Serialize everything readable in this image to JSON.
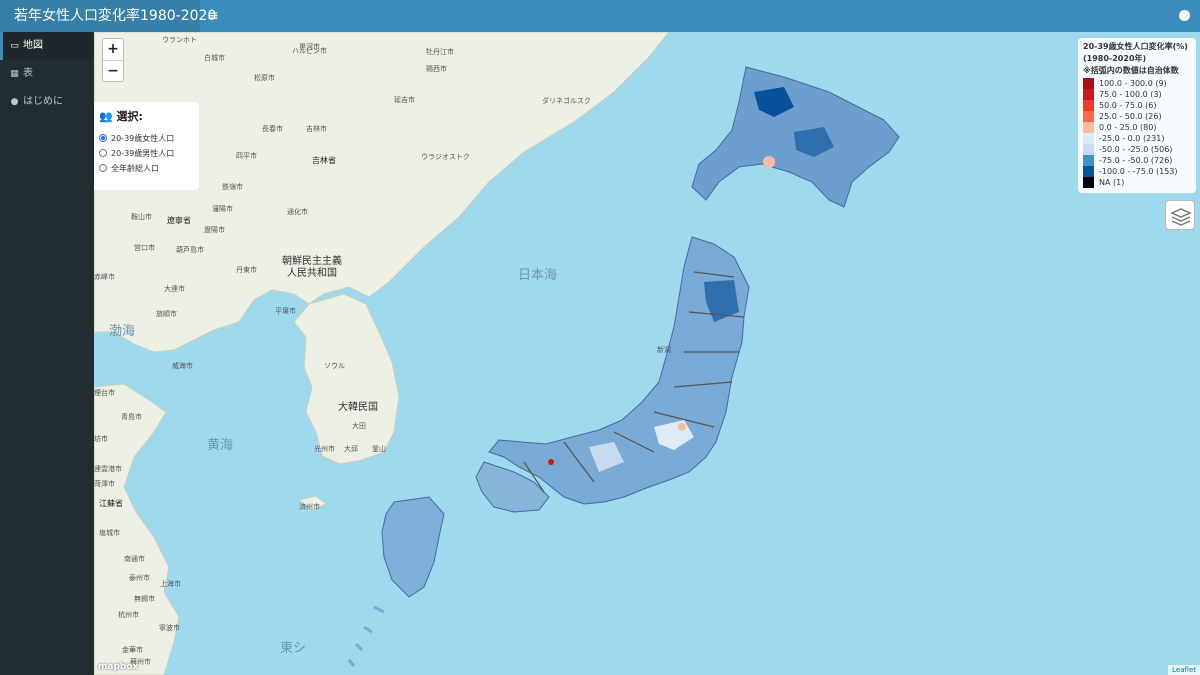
{
  "header": {
    "title": "若年女性人口変化率1980-2020",
    "menu_icon": "hamburger-icon",
    "repo_icon": "github-icon"
  },
  "sidebar": {
    "items": [
      {
        "label": "地図",
        "icon": "map-icon",
        "glyph": "▭",
        "active": true
      },
      {
        "label": "表",
        "icon": "table-icon",
        "glyph": "▦",
        "active": false
      },
      {
        "label": "はじめに",
        "icon": "info-icon",
        "glyph": "●",
        "active": false
      }
    ]
  },
  "map": {
    "zoom_in": "+",
    "zoom_out": "−",
    "labels": {
      "uranhot": "ウランホト",
      "heihe": "黒河市",
      "harbin": "ハルビン市",
      "mudanjiang": "牡丹江市",
      "jixi": "鶏西市",
      "baicheng": "白城市",
      "songyuan": "松原市",
      "changchun": "長春市",
      "jilin_city": "吉林市",
      "jilin_prov": "吉林省",
      "siping": "四平市",
      "yanji": "延吉市",
      "dalian": "遼陽市",
      "ulakit": "ウラジオストク",
      "danyang": "丹東市",
      "pyongyang": "平壌市",
      "seoul": "ソウル",
      "busan": "釜山",
      "jeju": "済州市",
      "gwangju": "光州市",
      "daejeon": "大田",
      "nagasaki": "大邱",
      "sea_of_japan": "日本海",
      "bohai": "渤海",
      "yellow_sea": "黄海",
      "east_sea": "東シ",
      "niigata": "新潟",
      "dalinegorsk": "ダリネゴルスク",
      "liaoning": "遼寧省",
      "korea_nk": "朝鮮民主主義\n人民共和国",
      "korea_sk": "大韓民国",
      "jiangsu": "江蘇省",
      "qingdao": "青島市",
      "weihai": "威海市",
      "yantai": "煙台市",
      "dandong2": "通化市",
      "tieling": "鉄嶺市",
      "shenyang": "瀋陽市",
      "anshan": "鞍山市",
      "yingkou": "営口市",
      "huludao": "葫芦島市",
      "chifeng": "赤峰市",
      "dalian2": "大連市",
      "lushun": "旅順市",
      "nantong": "南通市",
      "shanghai": "上海市",
      "hangzhou": "杭州市",
      "ningbo": "寧波市",
      "suzhou": "蘇州市",
      "taizhou": "泰州市",
      "wuxi": "無錫市",
      "jinhua": "金華市",
      "weifang": "坊市",
      "lianyungang": "連雲港市",
      "heze": "菏澤市",
      "yancheng": "塩城市"
    },
    "credit": "mapbox",
    "attribution": "Leaflet",
    "layers_icon": "layers-icon"
  },
  "selector": {
    "title": "選択:",
    "icon": "users-icon",
    "options": [
      {
        "label": "20-39歳女性人口",
        "checked": true
      },
      {
        "label": "20-39歳男性人口",
        "checked": false
      },
      {
        "label": "全年齢総人口",
        "checked": false
      }
    ]
  },
  "legend": {
    "title_1": "20-39歳女性人口変化率(%)",
    "title_2": "(1980-2020年)",
    "title_3": "※括弧内の数値は自治体数",
    "items": [
      {
        "label": "100.0 - 300.0 (9)",
        "color": "#a50f15"
      },
      {
        "label": "75.0 - 100.0 (3)",
        "color": "#cb181d"
      },
      {
        "label": "50.0 - 75.0 (6)",
        "color": "#ef3b2c"
      },
      {
        "label": "25.0 - 50.0 (26)",
        "color": "#fb6a4a"
      },
      {
        "label": "0.0 - 25.0 (80)",
        "color": "#fcbba1"
      },
      {
        "label": "-25.0 - 0.0 (231)",
        "color": "#deebf7"
      },
      {
        "label": "-50.0 - -25.0 (506)",
        "color": "#c6dbef"
      },
      {
        "label": "-75.0 - -50.0 (726)",
        "color": "#4292c6"
      },
      {
        "label": "-100.0 - -75.0 (153)",
        "color": "#08519c"
      },
      {
        "label": "NA (1)",
        "color": "#000000"
      }
    ]
  }
}
